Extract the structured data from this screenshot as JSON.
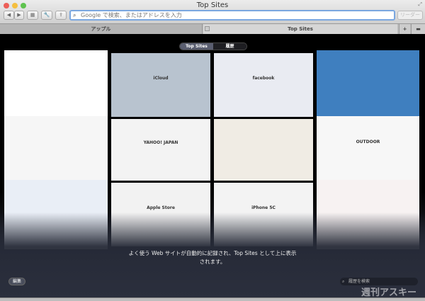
{
  "window": {
    "title": "Top Sites"
  },
  "toolbar": {
    "address_placeholder": "Google で検索、またはアドレスを入力",
    "reader_label": "リーダー",
    "back": "◀",
    "forward": "▶",
    "plus": "+"
  },
  "tabs": [
    {
      "label": "アップル"
    },
    {
      "label": "Top Sites",
      "active": true
    }
  ],
  "segment": {
    "top_sites": "Top Sites",
    "history": "履歴"
  },
  "thumbnails": [
    {
      "label": "",
      "bg": "#ffffff"
    },
    {
      "label": "iCloud",
      "bg": "#b8c3cf"
    },
    {
      "label": "facebook",
      "bg": "#e9ebf2"
    },
    {
      "label": "",
      "bg": "#3f7fbf"
    },
    {
      "label": "",
      "bg": "#f6f6f6"
    },
    {
      "label": "YAHOO! JAPAN",
      "bg": "#f3f3f3"
    },
    {
      "label": "",
      "bg": "#f0ece4"
    },
    {
      "label": "OUTDOOR",
      "bg": "#f7f7f7"
    },
    {
      "label": "",
      "bg": "#e9eef6"
    },
    {
      "label": "Apple Store",
      "bg": "#f2f2f2"
    },
    {
      "label": "iPhone 5C",
      "bg": "#f3f3f3"
    },
    {
      "label": "",
      "bg": "#f7f2f2"
    }
  ],
  "caption": "よく使う Web サイトが自動的に記録され、Top Sites として上に表示されます。",
  "footer": {
    "edit_label": "編集",
    "search_placeholder": "履歴を検索",
    "watermark": "週刊アスキー"
  },
  "colors": {
    "address_focus": "#7aa7e0",
    "close": "#ec5f58",
    "minimize": "#f5bf3f",
    "zoom": "#5fc34f"
  }
}
